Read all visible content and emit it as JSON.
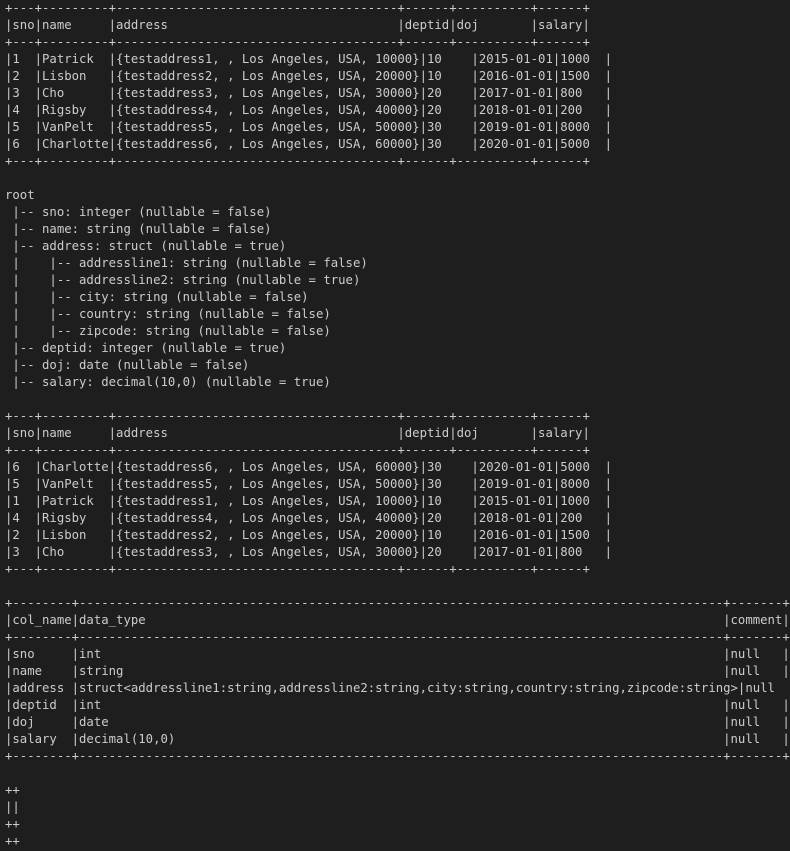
{
  "terminal": {
    "lines": [
      "+---+---------+--------------------------------------+------+----------+------+",
      "|sno|name     |address                               |deptid|doj       |salary|",
      "+---+---------+--------------------------------------+------+----------+------+",
      "|1  |Patrick  |{testaddress1, , Los Angeles, USA, 10000}|10    |2015-01-01|1000  |",
      "|2  |Lisbon   |{testaddress2, , Los Angeles, USA, 20000}|10    |2016-01-01|1500  |",
      "|3  |Cho      |{testaddress3, , Los Angeles, USA, 30000}|20    |2017-01-01|800   |",
      "|4  |Rigsby   |{testaddress4, , Los Angeles, USA, 40000}|20    |2018-01-01|200   |",
      "|5  |VanPelt  |{testaddress5, , Los Angeles, USA, 50000}|30    |2019-01-01|8000  |",
      "|6  |Charlotte|{testaddress6, , Los Angeles, USA, 60000}|30    |2020-01-01|5000  |",
      "+---+---------+--------------------------------------+------+----------+------+",
      "",
      "root",
      " |-- sno: integer (nullable = false)",
      " |-- name: string (nullable = false)",
      " |-- address: struct (nullable = true)",
      " |    |-- addressline1: string (nullable = false)",
      " |    |-- addressline2: string (nullable = true)",
      " |    |-- city: string (nullable = false)",
      " |    |-- country: string (nullable = false)",
      " |    |-- zipcode: string (nullable = false)",
      " |-- deptid: integer (nullable = true)",
      " |-- doj: date (nullable = false)",
      " |-- salary: decimal(10,0) (nullable = true)",
      "",
      "+---+---------+--------------------------------------+------+----------+------+",
      "|sno|name     |address                               |deptid|doj       |salary|",
      "+---+---------+--------------------------------------+------+----------+------+",
      "|6  |Charlotte|{testaddress6, , Los Angeles, USA, 60000}|30    |2020-01-01|5000  |",
      "|5  |VanPelt  |{testaddress5, , Los Angeles, USA, 50000}|30    |2019-01-01|8000  |",
      "|1  |Patrick  |{testaddress1, , Los Angeles, USA, 10000}|10    |2015-01-01|1000  |",
      "|4  |Rigsby   |{testaddress4, , Los Angeles, USA, 40000}|20    |2018-01-01|200   |",
      "|2  |Lisbon   |{testaddress2, , Los Angeles, USA, 20000}|10    |2016-01-01|1500  |",
      "|3  |Cho      |{testaddress3, , Los Angeles, USA, 30000}|20    |2017-01-01|800   |",
      "+---+---------+--------------------------------------+------+----------+------+",
      "",
      "+--------+---------------------------------------------------------------------------------------+-------+",
      "|col_name|data_type                                                                              |comment|",
      "+--------+---------------------------------------------------------------------------------------+-------+",
      "|sno     |int                                                                                    |null   |",
      "|name    |string                                                                                 |null   |",
      "|address |struct<addressline1:string,addressline2:string,city:string,country:string,zipcode:string>|null   |",
      "|deptid  |int                                                                                    |null   |",
      "|doj     |date                                                                                   |null   |",
      "|salary  |decimal(10,0)                                                                          |null   |",
      "+--------+---------------------------------------------------------------------------------------+-------+",
      "",
      "++",
      "||",
      "++",
      "++"
    ]
  }
}
